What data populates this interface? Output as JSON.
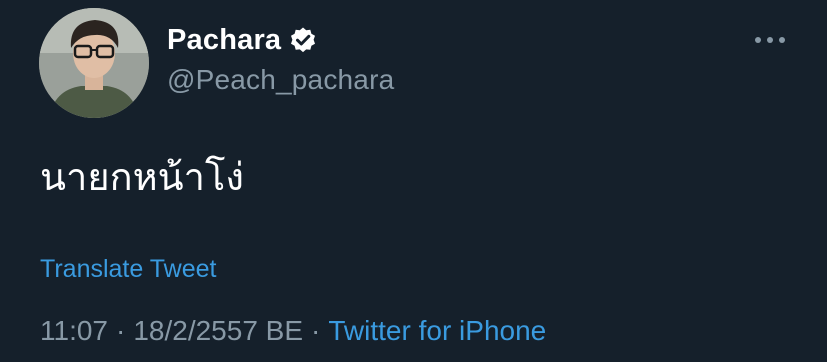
{
  "author": {
    "display_name": "Pachara",
    "handle": "@Peach_pachara",
    "verified": true
  },
  "tweet": {
    "text": "นายกหน้าโง่",
    "translate_label": "Translate Tweet",
    "time": "11:07",
    "separator": "·",
    "date": "18/2/2557 BE",
    "source": "Twitter for iPhone"
  },
  "icons": {
    "verified": "verified-badge-icon",
    "more": "more-options-icon"
  },
  "colors": {
    "background": "#15202b",
    "primary_text": "#ffffff",
    "secondary_text": "#8899a6",
    "link": "#3a9be0"
  }
}
